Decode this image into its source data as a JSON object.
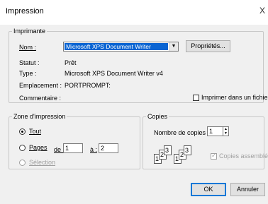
{
  "window": {
    "title": "Impression",
    "close_label": "X"
  },
  "printer": {
    "legend": "Imprimante",
    "name_label": "Nom :",
    "name_value": "Microsoft XPS Document Writer",
    "properties_button": "Propriétés...",
    "status_label": "Statut :",
    "status_value": "Prêt",
    "type_label": "Type :",
    "type_value": "Microsoft XPS Document Writer v4",
    "location_label": "Emplacement :",
    "location_value": "PORTPROMPT:",
    "comment_label": "Commentaire :",
    "print_to_file_label": "Imprimer dans un fichier"
  },
  "range": {
    "legend": "Zone d'impression",
    "all_label": "Tout",
    "pages_label": "Pages",
    "from_label": "de :",
    "from_value": "1",
    "to_label": "à :",
    "to_value": "2",
    "selection_label": "Sélection"
  },
  "copies": {
    "legend": "Copies",
    "count_label": "Nombre de copies :",
    "count_value": "1",
    "collate_label": "Copies assemblées",
    "collate_pages": [
      "1",
      "2",
      "3",
      "1",
      "2",
      "3"
    ]
  },
  "buttons": {
    "ok": "OK",
    "cancel": "Annuler"
  }
}
